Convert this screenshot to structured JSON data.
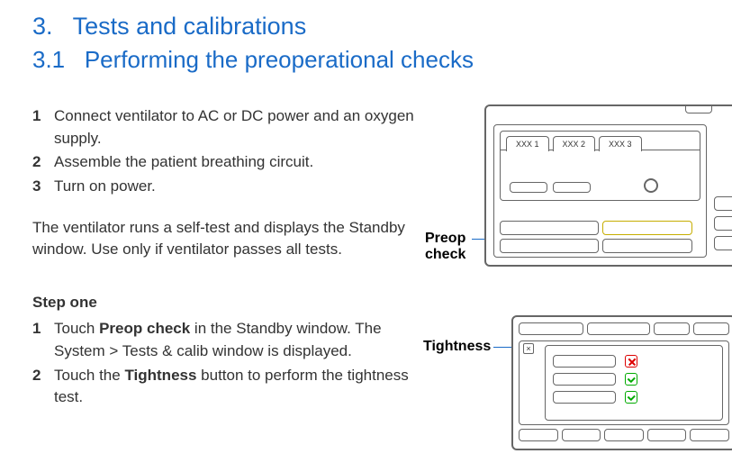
{
  "heading": {
    "num": "3.",
    "title": "Tests and calibrations"
  },
  "subheading": {
    "num": "3.1",
    "title": "Performing the preoperational checks"
  },
  "preList": [
    "Connect ventilator to AC or DC power and an oxygen supply.",
    "Assemble the patient breathing circuit.",
    "Turn on power."
  ],
  "preListNums": [
    "1",
    "2",
    "3"
  ],
  "para1": "The ventilator runs a self-test and displays the Standby window. Use only if ventilator passes all tests.",
  "stepOne": {
    "head": "Step one",
    "items": [
      {
        "n": "1",
        "pre": "Touch ",
        "bold": "Preop check",
        "post": " in the Standby window. The System > Tests & calib window is displayed."
      },
      {
        "n": "2",
        "pre": "Touch the ",
        "bold": "Tightness",
        "post": " button to perform the tightness test."
      }
    ]
  },
  "callouts": {
    "preop": "Preop check",
    "tightness": "Tightness"
  },
  "illu1": {
    "tab1": "XXX 1",
    "tab2": "XXX 2",
    "tab3": "XXX 3"
  }
}
